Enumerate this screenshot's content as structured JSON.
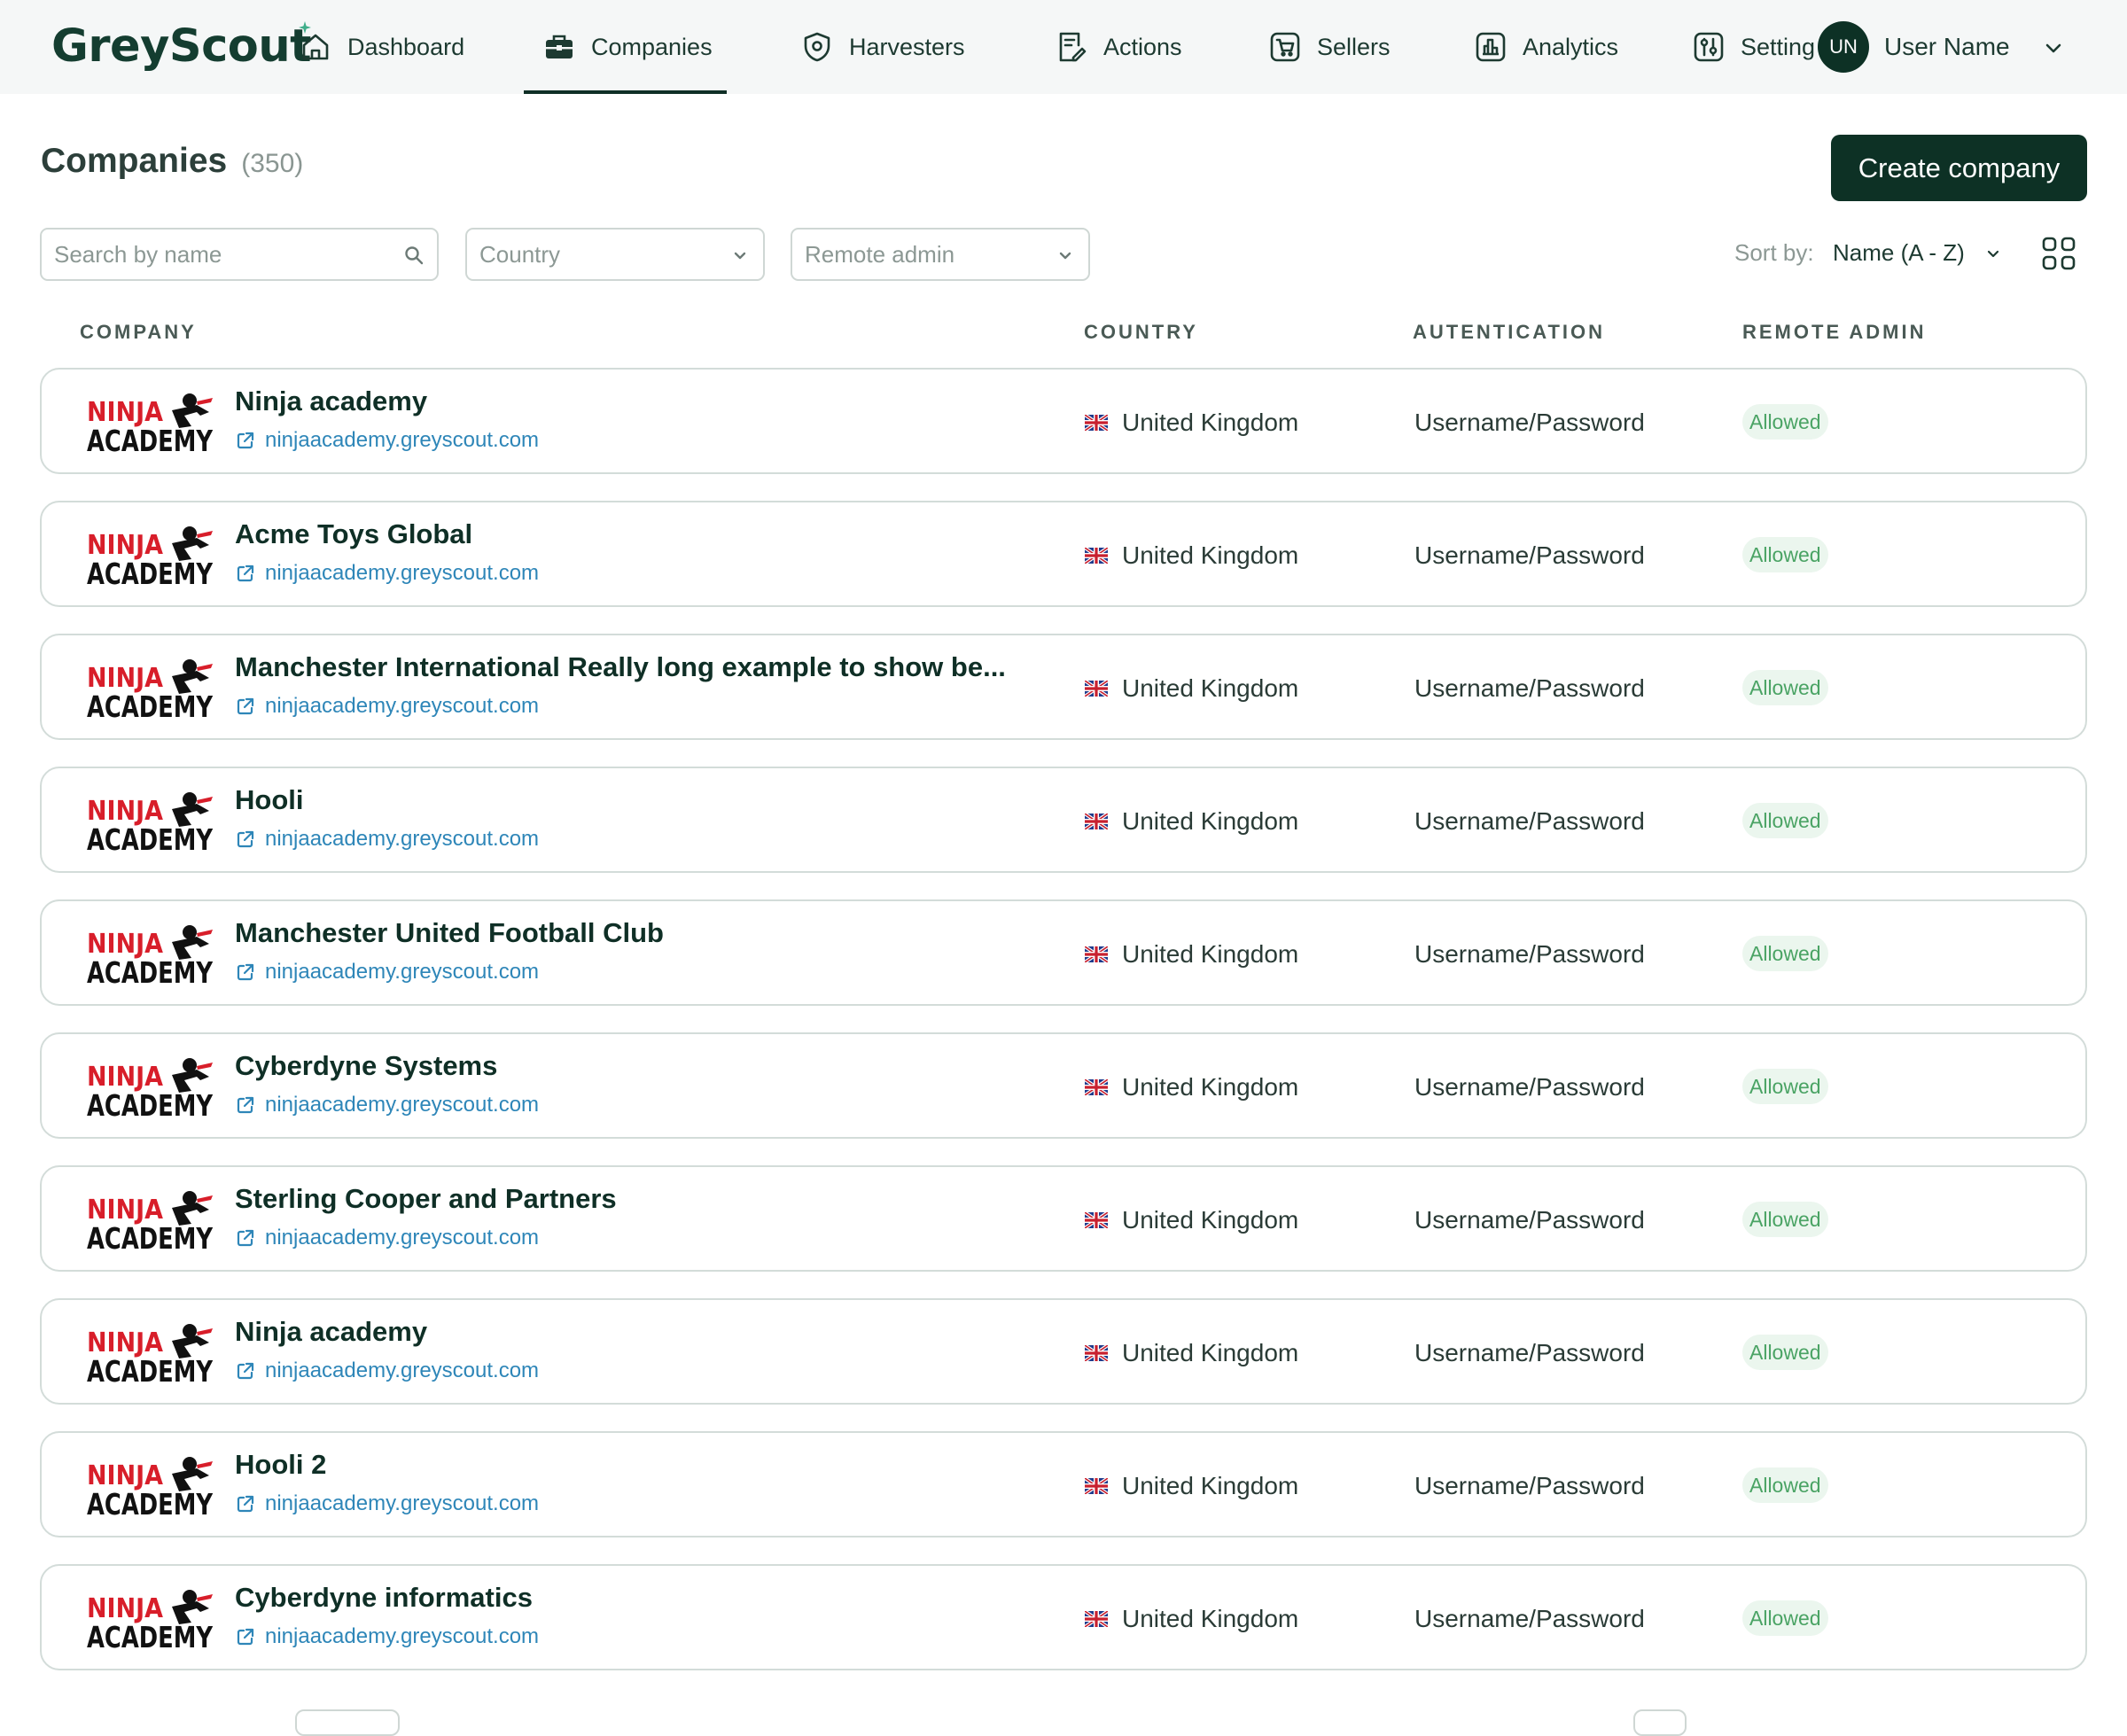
{
  "app": {
    "logo_text": "GreyScout"
  },
  "nav": {
    "items": [
      {
        "label": "Dashboard",
        "icon": "home-icon"
      },
      {
        "label": "Companies",
        "icon": "briefcase-icon",
        "active": true
      },
      {
        "label": "Harvesters",
        "icon": "shield-gear-icon"
      },
      {
        "label": "Actions",
        "icon": "checklist-edit-icon"
      },
      {
        "label": "Sellers",
        "icon": "cart-icon"
      },
      {
        "label": "Analytics",
        "icon": "bar-chart-icon"
      },
      {
        "label": "Setting",
        "icon": "sliders-icon"
      }
    ],
    "user_initials": "UN",
    "user_name": "User Name"
  },
  "page": {
    "title": "Companies",
    "count": "(350)",
    "create_button": "Create company"
  },
  "filters": {
    "search_placeholder": "Search by name",
    "country_placeholder": "Country",
    "remote_admin_placeholder": "Remote admin",
    "sort_label": "Sort by:",
    "sort_value": "Name (A - Z)"
  },
  "table": {
    "headers": {
      "company": "COMPANY",
      "country": "COUNTRY",
      "auth": "AUTENTICATION",
      "remote_admin": "REMOTE ADMIN"
    },
    "rows": [
      {
        "name": "Ninja academy",
        "url": "ninjaacademy.greyscout.com",
        "country": "United Kingdom",
        "auth": "Username/Password",
        "remote_admin": "Allowed"
      },
      {
        "name": "Acme Toys Global",
        "url": "ninjaacademy.greyscout.com",
        "country": "United Kingdom",
        "auth": "Username/Password",
        "remote_admin": "Allowed"
      },
      {
        "name": "Manchester International Really long example to show be...",
        "url": "ninjaacademy.greyscout.com",
        "country": "United Kingdom",
        "auth": "Username/Password",
        "remote_admin": "Allowed"
      },
      {
        "name": "Hooli",
        "url": "ninjaacademy.greyscout.com",
        "country": "United Kingdom",
        "auth": "Username/Password",
        "remote_admin": "Allowed"
      },
      {
        "name": "Manchester United Football Club",
        "url": "ninjaacademy.greyscout.com",
        "country": "United Kingdom",
        "auth": "Username/Password",
        "remote_admin": "Allowed"
      },
      {
        "name": "Cyberdyne Systems",
        "url": "ninjaacademy.greyscout.com",
        "country": "United Kingdom",
        "auth": "Username/Password",
        "remote_admin": "Allowed"
      },
      {
        "name": "Sterling Cooper and Partners",
        "url": "ninjaacademy.greyscout.com",
        "country": "United Kingdom",
        "auth": "Username/Password",
        "remote_admin": "Allowed"
      },
      {
        "name": "Ninja academy",
        "url": "ninjaacademy.greyscout.com",
        "country": "United Kingdom",
        "auth": "Username/Password",
        "remote_admin": "Allowed"
      },
      {
        "name": "Hooli 2",
        "url": "ninjaacademy.greyscout.com",
        "country": "United Kingdom",
        "auth": "Username/Password",
        "remote_admin": "Allowed"
      },
      {
        "name": "Cyberdyne informatics",
        "url": "ninjaacademy.greyscout.com",
        "country": "United Kingdom",
        "auth": "Username/Password",
        "remote_admin": "Allowed"
      }
    ],
    "company_logo_text": [
      "NINJA",
      "ACADEMY"
    ]
  },
  "colors": {
    "brand_dark": "#0d3125",
    "link": "#2e86b8",
    "badge_bg": "#ebf6ee",
    "badge_text": "#4aa364"
  }
}
